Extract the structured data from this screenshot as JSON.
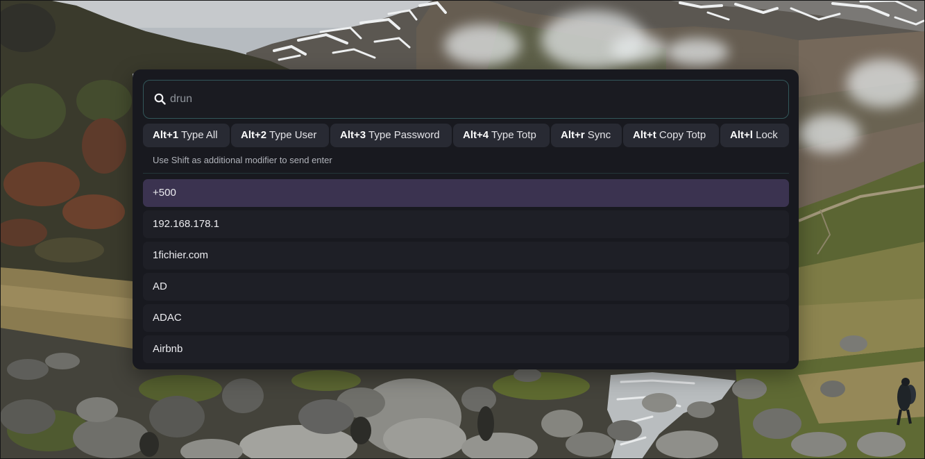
{
  "launcher": {
    "search": {
      "placeholder": "drun",
      "value": ""
    },
    "keybindings": [
      {
        "key": "Alt+1",
        "label": "Type All"
      },
      {
        "key": "Alt+2",
        "label": "Type User"
      },
      {
        "key": "Alt+3",
        "label": "Type Password"
      },
      {
        "key": "Alt+4",
        "label": "Type Totp"
      },
      {
        "key": "Alt+r",
        "label": "Sync"
      },
      {
        "key": "Alt+t",
        "label": "Copy Totp"
      },
      {
        "key": "Alt+l",
        "label": "Lock"
      }
    ],
    "hint": "Use Shift as additional modifier to send enter",
    "selected_index": 0,
    "entries": [
      {
        "label": "+500"
      },
      {
        "label": "192.168.178.1"
      },
      {
        "label": "1fichier.com"
      },
      {
        "label": "AD"
      },
      {
        "label": "ADAC"
      },
      {
        "label": "Airbnb"
      }
    ]
  },
  "icons": {
    "search": "search-icon"
  },
  "colors": {
    "panel_background": "#18191f",
    "search_background": "#1a1b21",
    "search_border": "#33575a",
    "placeholder_text": "#8f949b",
    "chip_background": "#282a33",
    "entry_background": "#1e1f26",
    "selected_background": "#3b3350",
    "separator": "#24363a",
    "text": "#ececf0",
    "muted_text": "#b1b4bb"
  }
}
